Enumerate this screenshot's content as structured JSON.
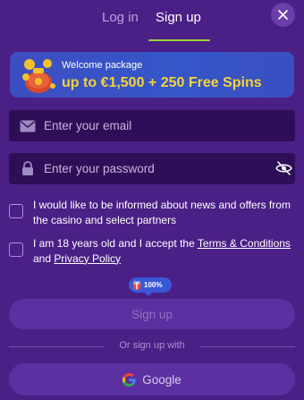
{
  "tabs": {
    "login": "Log in",
    "signup": "Sign up",
    "active": "signup"
  },
  "banner": {
    "subtitle": "Welcome package",
    "headline": "up to €1,500 + 250 Free Spins",
    "icon": "gift-bag-icon"
  },
  "form": {
    "email_placeholder": "Enter your email",
    "password_placeholder": "Enter your password"
  },
  "consents": {
    "news": {
      "text": "I would like to be informed about news and offers from the casino and select partners",
      "checked": false
    },
    "age": {
      "prefix": "I am 18 years old and I accept the ",
      "terms_link": "Terms & Conditions",
      "middle": " and ",
      "privacy_link": "Privacy Policy",
      "checked": false
    }
  },
  "badge": {
    "text": "100%"
  },
  "buttons": {
    "signup": "Sign up",
    "or_text": "Or sign up with",
    "google": "Google"
  },
  "colors": {
    "background": "#4a1f86",
    "accent": "#9bd53a",
    "headline": "#f5d33a",
    "banner": "#3556c9"
  }
}
